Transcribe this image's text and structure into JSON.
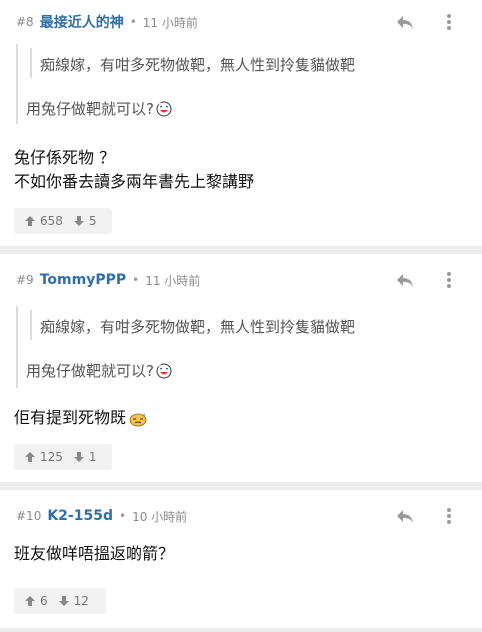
{
  "posts": [
    {
      "number": "#8",
      "username": "最接近人的神",
      "separator": "•",
      "time": "11 小時前",
      "quote": "痴線嫁，有咁多死物做靶，無人性到拎隻貓做靶",
      "reply_quote": "用兔仔做靶就可以?",
      "content": [
        "兔仔係死物 ？",
        "不如你番去讀多兩年書先上黎講野"
      ],
      "upvotes": "658",
      "downvotes": "5"
    },
    {
      "number": "#9",
      "username": "TommyPPP",
      "separator": "•",
      "time": "11 小時前",
      "quote": "痴線嫁，有咁多死物做靶，無人性到拎隻貓做靶",
      "reply_quote": "用兔仔做靶就可以?",
      "content": [
        "佢有提到死物既"
      ],
      "upvotes": "125",
      "downvotes": "1"
    },
    {
      "number": "#10",
      "username": "K2-155d",
      "separator": "•",
      "time": "10 小時前",
      "content": [
        "班友做咩唔搵返啲箭？"
      ],
      "upvotes": "6",
      "downvotes": "12"
    }
  ],
  "icons": {
    "reply": "reply-icon",
    "more": "more-icon",
    "upvote": "upvote-arrow-icon",
    "downvote": "downvote-arrow-icon",
    "laugh": "laughing-emoji-icon",
    "sweat": "sweat-emoji-icon"
  },
  "colors": {
    "username": "#2f6fa8",
    "meta": "#8a8a8a",
    "background": "#ececec"
  }
}
